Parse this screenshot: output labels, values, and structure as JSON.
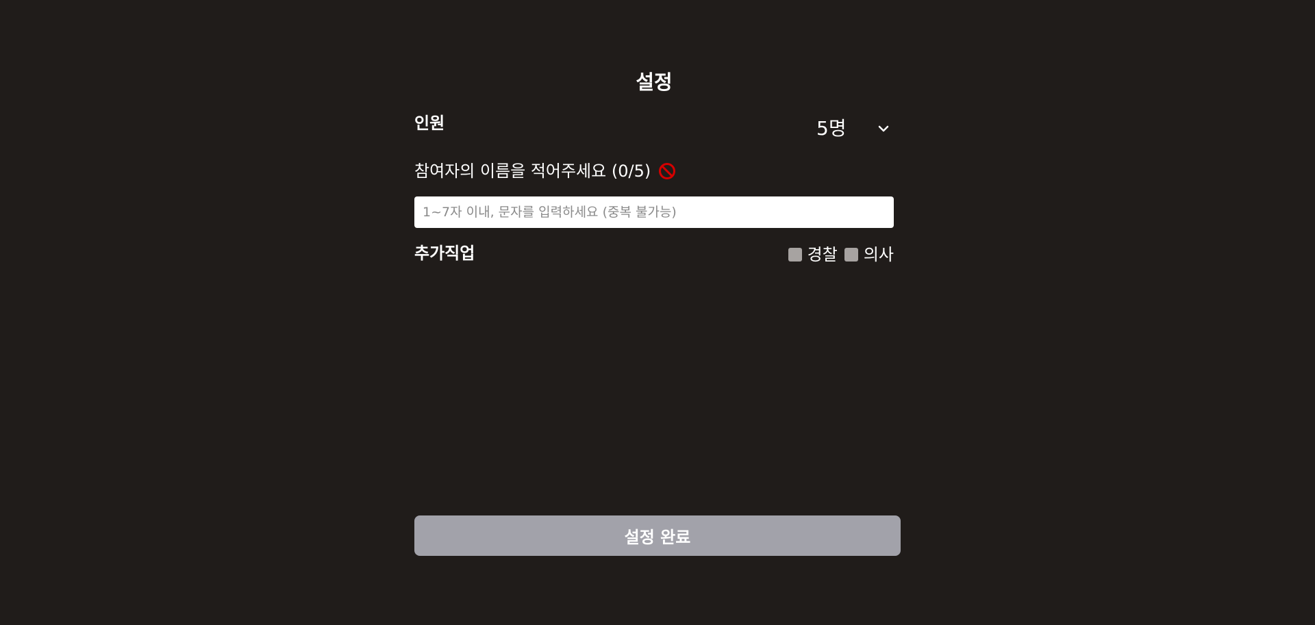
{
  "title": "설정",
  "people": {
    "label": "인원",
    "selected": "5명",
    "chevron_icon": "chevron-down-icon"
  },
  "names": {
    "label": "참여자의 이름을 적어주세요 (0/5)",
    "status_icon": "prohibited-icon",
    "status_color": "#d50000",
    "input_value": "",
    "input_placeholder": "1~7자 이내, 문자를 입력하세요 (중복 불가능)"
  },
  "jobs": {
    "label": "추가직업",
    "options": [
      {
        "label": "경찰",
        "checked": false
      },
      {
        "label": "의사",
        "checked": false
      }
    ]
  },
  "submit": {
    "label": "설정 완료",
    "color": "#a2a2aa"
  },
  "colors": {
    "background": "#201c1a",
    "text": "#ffffff",
    "checkbox": "#a7a3a1"
  }
}
